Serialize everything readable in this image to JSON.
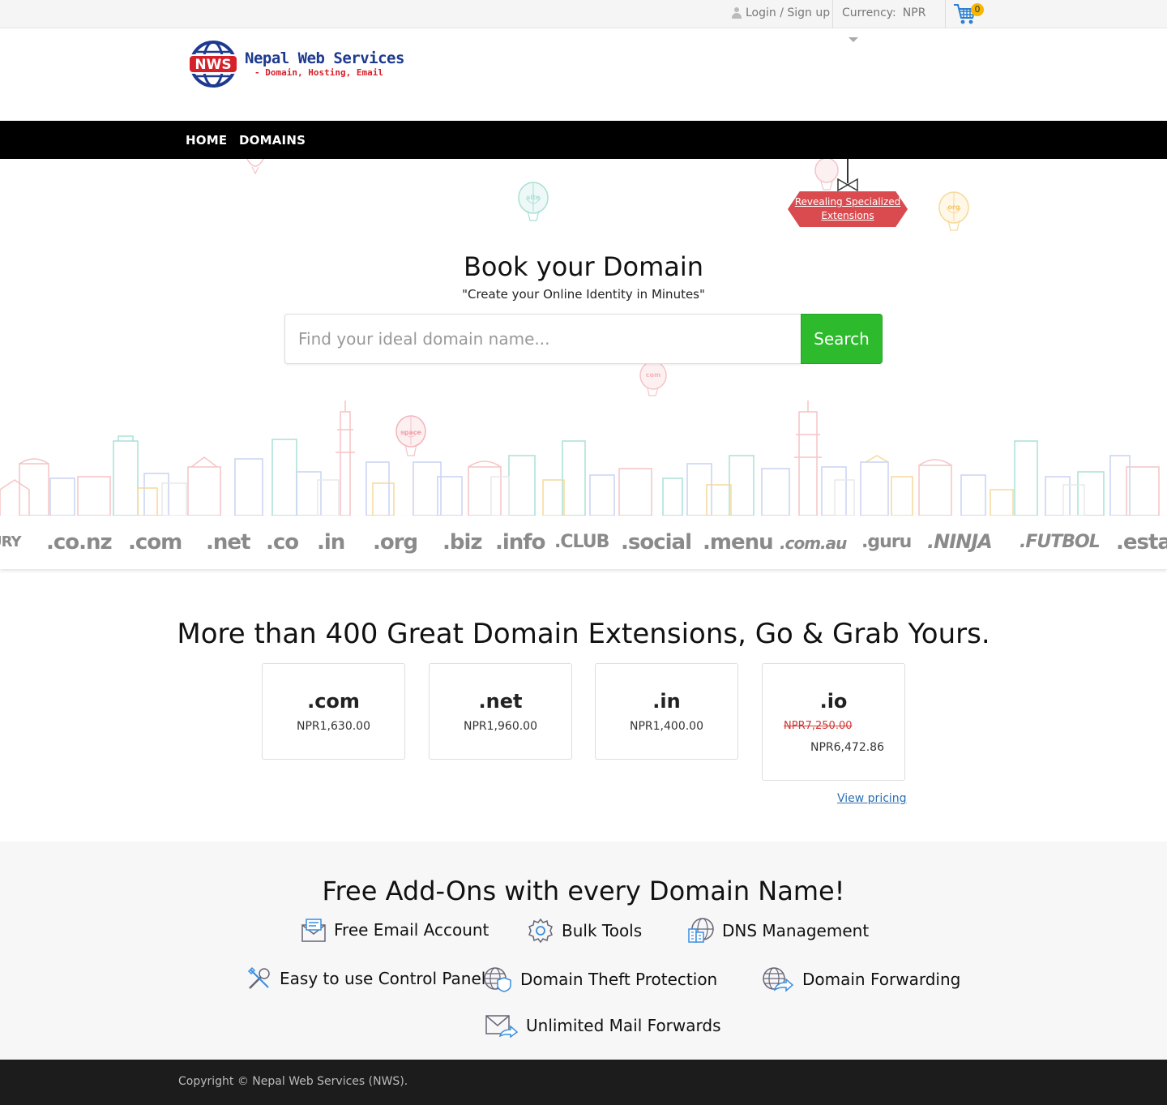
{
  "topbar": {
    "login_label": "Login / Sign up",
    "currency_label": "Currency:",
    "currency_value": "NPR",
    "cart_count": "0"
  },
  "logo": {
    "badge_text": "NWS",
    "title": "Nepal Web Services",
    "subtitle": "- Domain, Hosting, Email"
  },
  "nav": {
    "items": [
      {
        "label": "HOME"
      },
      {
        "label": "DOMAINS"
      }
    ]
  },
  "hero": {
    "ribbon_text": "Revealing Specialized Extensions",
    "title": "Book your Domain",
    "subtitle": "\"Create your Online Identity in Minutes\"",
    "search_placeholder": "Find your ideal domain name...",
    "search_button": "Search",
    "balloon_labels": [
      "site",
      "com",
      "org",
      "space"
    ]
  },
  "tld_strip": [
    ".co.nz",
    ".com",
    ".net",
    ".co",
    ".in",
    ".org",
    ".biz",
    ".info",
    ".CLUB",
    ".social",
    ".menu",
    ".com.au",
    ".guru",
    ".NINJA",
    ".FUTBOL",
    ".estat"
  ],
  "extensions": {
    "title": "More than 400 Great Domain Extensions, Go & Grab Yours.",
    "cards": [
      {
        "tld": ".com",
        "price": "NPR1,630.00"
      },
      {
        "tld": ".net",
        "price": "NPR1,960.00"
      },
      {
        "tld": ".in",
        "price": "NPR1,400.00"
      },
      {
        "tld": ".io",
        "old_price": "NPR7,250.00",
        "price": "NPR6,472.86"
      }
    ],
    "view_pricing": "View pricing"
  },
  "addons": {
    "title": "Free Add-Ons with every Domain Name!",
    "items": [
      {
        "label": "Free Email Account",
        "icon": "email-icon"
      },
      {
        "label": "Bulk Tools",
        "icon": "gear-icon"
      },
      {
        "label": "DNS Management",
        "icon": "dns-icon"
      },
      {
        "label": "Easy to use Control Panel",
        "icon": "tools-icon"
      },
      {
        "label": "Domain Theft Protection",
        "icon": "shield-globe-icon"
      },
      {
        "label": "Domain Forwarding",
        "icon": "globe-forward-icon"
      },
      {
        "label": "Unlimited Mail Forwards",
        "icon": "mail-forward-icon"
      }
    ]
  },
  "footer": {
    "copyright": "Copyright © Nepal Web Services (NWS)."
  },
  "colors": {
    "search_button": "#2dbb2d",
    "nav_bg": "#000000",
    "ribbon": "#d94b4f",
    "brand_blue": "#1d3a8f",
    "brand_red": "#d6202a",
    "link": "#2a6fb5"
  }
}
